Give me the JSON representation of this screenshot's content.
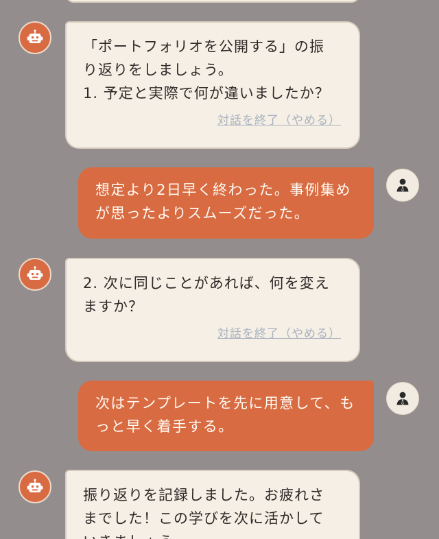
{
  "messages": [
    {
      "role": "bot",
      "lines": [
        "「ポートフォリオを公開する」の振",
        "り返りをしましょう。",
        "1. 予定と実際で何が違いましたか？"
      ],
      "end_link": "対話を終了（やめる）"
    },
    {
      "role": "user",
      "lines": [
        "想定より2日早く終わった。事例集め",
        "が思ったよりスムーズだった。"
      ]
    },
    {
      "role": "bot",
      "lines": [
        "2. 次に同じことがあれば、何を変え",
        "ますか？"
      ],
      "end_link": "対話を終了（やめる）"
    },
    {
      "role": "user",
      "lines": [
        "次はテンプレートを先に用意して、も",
        "っと早く着手する。"
      ]
    },
    {
      "role": "bot",
      "lines": [
        "振り返りを記録しました。お疲れさ",
        "までした！この学びを次に活かして",
        "いきましょう。"
      ]
    }
  ],
  "icons": {
    "bot": "robot-icon",
    "user": "user-icon"
  },
  "colors": {
    "background": "#938e8d",
    "accent": "#d86b42",
    "bot_bubble": "#f5efe5",
    "link": "#a9b2be"
  }
}
